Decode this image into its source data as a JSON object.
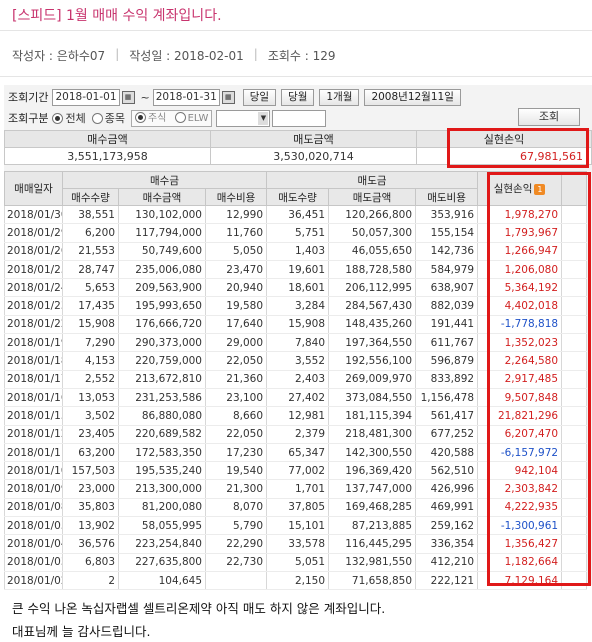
{
  "post": {
    "title": "[스피드] 1월 매매 수익 계좌입니다.",
    "author": "작성자 : 은하수07",
    "date": "작성일 : 2018-02-01",
    "views": "조회수 : 129"
  },
  "search": {
    "period_label": "조회기간",
    "start_date": "2018-01-01",
    "end_date": "2018-01-31",
    "btn_today": "당일",
    "btn_month": "당월",
    "btn_1month": "1개월",
    "date_display": "2008년12월11일",
    "type_label": "조회구분",
    "opt_all": "전체",
    "opt_stock": "종목",
    "opt_sub1": "주식",
    "opt_sub2": "ELW",
    "query_btn": "조회"
  },
  "summary": {
    "headers": [
      "매수금액",
      "매도금액",
      "실현손익"
    ],
    "values": [
      "3,551,173,958",
      "3,530,020,714",
      "67,981,561"
    ]
  },
  "table": {
    "date_header": "매매일자",
    "buy_group": "매수금",
    "sell_group": "매도금",
    "pl_header": "실현손익",
    "pl_badge": "1",
    "sub_headers": [
      "매수수량",
      "매수금액",
      "매수비용",
      "매도수량",
      "매도금액",
      "매도비용"
    ],
    "rows": [
      [
        "2018/01/30",
        "38,551",
        "130,102,000",
        "12,990",
        "36,451",
        "120,266,800",
        "353,916",
        "1,978,270"
      ],
      [
        "2018/01/29",
        "6,200",
        "117,794,000",
        "11,760",
        "5,751",
        "50,057,300",
        "155,154",
        "1,793,967"
      ],
      [
        "2018/01/26",
        "21,553",
        "50,749,600",
        "5,050",
        "1,403",
        "46,055,650",
        "142,736",
        "1,266,947"
      ],
      [
        "2018/01/25",
        "28,747",
        "235,006,080",
        "23,470",
        "19,601",
        "188,728,580",
        "584,979",
        "1,206,080"
      ],
      [
        "2018/01/24",
        "5,653",
        "209,563,900",
        "20,940",
        "18,601",
        "206,112,995",
        "638,907",
        "5,364,192"
      ],
      [
        "2018/01/23",
        "17,435",
        "195,993,650",
        "19,580",
        "3,284",
        "284,567,430",
        "882,039",
        "4,402,018"
      ],
      [
        "2018/01/22",
        "15,908",
        "176,666,720",
        "17,640",
        "15,908",
        "148,435,260",
        "191,441",
        "-1,778,818"
      ],
      [
        "2018/01/19",
        "7,290",
        "290,373,000",
        "29,000",
        "7,840",
        "197,364,550",
        "611,767",
        "1,352,023"
      ],
      [
        "2018/01/18",
        "4,153",
        "220,759,000",
        "22,050",
        "3,552",
        "192,556,100",
        "596,879",
        "2,264,580"
      ],
      [
        "2018/01/17",
        "2,552",
        "213,672,810",
        "21,360",
        "2,403",
        "269,009,970",
        "833,892",
        "2,917,485"
      ],
      [
        "2018/01/16",
        "13,053",
        "231,253,586",
        "23,100",
        "27,402",
        "373,084,550",
        "1,156,478",
        "9,507,848"
      ],
      [
        "2018/01/15",
        "3,502",
        "86,880,080",
        "8,660",
        "12,981",
        "181,115,394",
        "561,417",
        "21,821,296"
      ],
      [
        "2018/01/12",
        "23,405",
        "220,689,582",
        "22,050",
        "2,379",
        "218,481,300",
        "677,252",
        "6,207,470"
      ],
      [
        "2018/01/11",
        "63,200",
        "172,583,350",
        "17,230",
        "65,347",
        "142,300,550",
        "420,588",
        "-6,157,972"
      ],
      [
        "2018/01/10",
        "157,503",
        "195,535,240",
        "19,540",
        "77,002",
        "196,369,420",
        "562,510",
        "942,104"
      ],
      [
        "2018/01/09",
        "23,000",
        "213,300,000",
        "21,300",
        "1,701",
        "137,747,000",
        "426,996",
        "2,303,842"
      ],
      [
        "2018/01/08",
        "35,803",
        "81,200,080",
        "8,070",
        "37,805",
        "169,468,285",
        "469,991",
        "4,222,935"
      ],
      [
        "2018/01/05",
        "13,902",
        "58,055,995",
        "5,790",
        "15,101",
        "87,213,885",
        "259,162",
        "-1,300,961"
      ],
      [
        "2018/01/04",
        "36,576",
        "223,254,840",
        "22,290",
        "33,578",
        "116,445,295",
        "336,354",
        "1,356,427"
      ],
      [
        "2018/01/03",
        "6,803",
        "227,635,800",
        "22,730",
        "5,051",
        "132,981,550",
        "412,210",
        "1,182,664"
      ],
      [
        "2018/01/02",
        "2",
        "104,645",
        "",
        "2,150",
        "71,658,850",
        "222,121",
        "7,129,164"
      ]
    ]
  },
  "comment": {
    "line1": "큰 수익 나온 녹십자랩셀 셀트리온제약 아직 매도 하지 않은 계좌입니다.",
    "line2": "대표님께 늘 감사드립니다."
  },
  "colors": {
    "profit": "#d21f1f",
    "loss": "#1f52c8",
    "title": "#c8346e",
    "highlight_box": "#e01818"
  }
}
